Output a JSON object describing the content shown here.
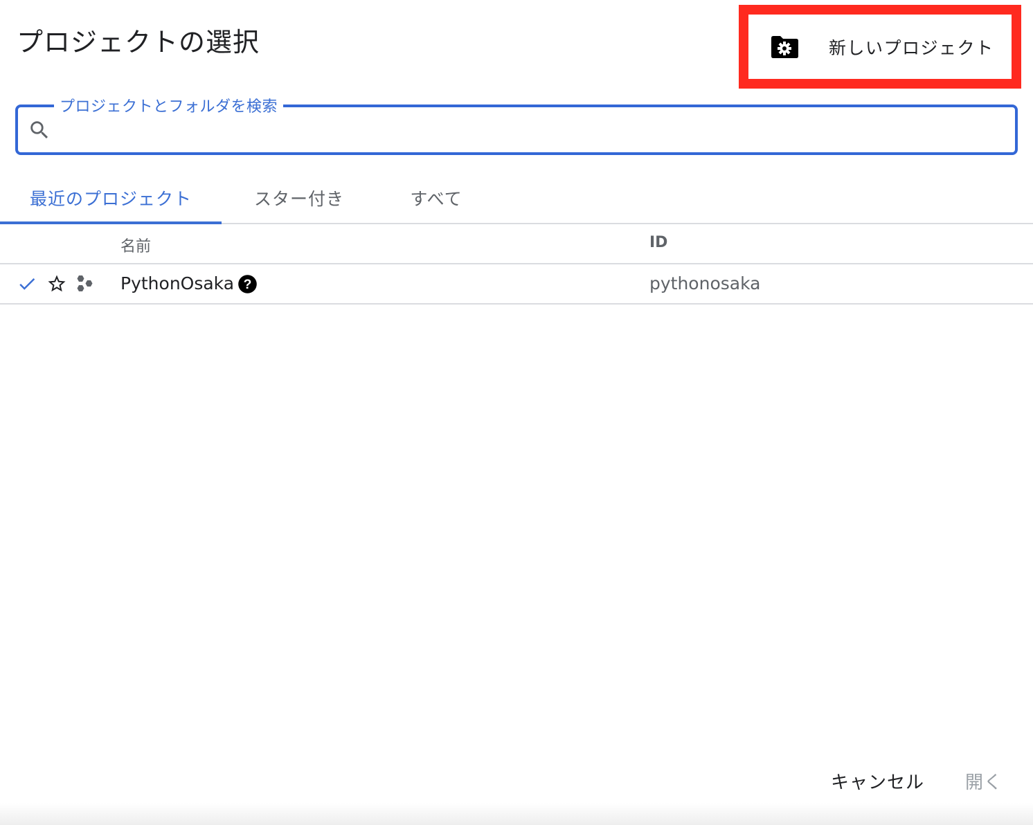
{
  "dialog": {
    "title": "プロジェクトの選択"
  },
  "new_project": {
    "label": "新しいプロジェクト",
    "icon": "folder-settings-icon"
  },
  "search": {
    "label": "プロジェクトとフォルダを検索",
    "value": "",
    "icon": "search-icon"
  },
  "tabs": [
    {
      "label": "最近のプロジェクト",
      "active": true
    },
    {
      "label": "スター付き",
      "active": false
    },
    {
      "label": "すべて",
      "active": false
    }
  ],
  "table": {
    "columns": {
      "name": "名前",
      "id": "ID"
    },
    "rows": [
      {
        "selected": true,
        "starred": false,
        "name": "PythonOsaka",
        "id": "pythonosaka",
        "icons": [
          "check-icon",
          "star-outline-icon",
          "project-hexagon-icon",
          "help-icon"
        ]
      }
    ]
  },
  "footer": {
    "cancel_label": "キャンセル",
    "open_label": "開く"
  },
  "colors": {
    "accent": "#3b6fd4",
    "highlight": "#ff2a1f",
    "disabled": "#9aa0a6"
  }
}
